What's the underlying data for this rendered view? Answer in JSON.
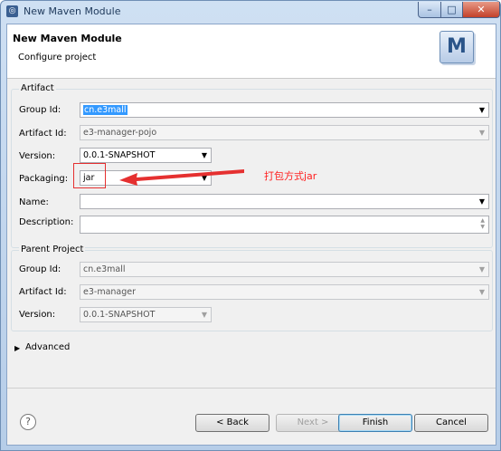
{
  "window": {
    "title": "New Maven Module",
    "controls": {
      "minimize": "–",
      "maximize": "□",
      "close": "✕"
    }
  },
  "header": {
    "title": "New Maven Module",
    "subtitle": "Configure project",
    "logo_letter": "M"
  },
  "artifact": {
    "section_label": "Artifact",
    "group_id_label": "Group Id:",
    "group_id_value": "cn.e3mall",
    "artifact_id_label": "Artifact Id:",
    "artifact_id_value": "e3-manager-pojo",
    "version_label": "Version:",
    "version_value": "0.0.1-SNAPSHOT",
    "packaging_label": "Packaging:",
    "packaging_value": "jar",
    "name_label": "Name:",
    "name_value": "",
    "description_label": "Description:",
    "description_value": ""
  },
  "parent": {
    "section_label": "Parent Project",
    "group_id_label": "Group Id:",
    "group_id_value": "cn.e3mall",
    "artifact_id_label": "Artifact Id:",
    "artifact_id_value": "e3-manager",
    "version_label": "Version:",
    "version_value": "0.0.1-SNAPSHOT"
  },
  "advanced": {
    "label": "Advanced"
  },
  "buttons": {
    "help": "?",
    "back": "< Back",
    "next": "Next >",
    "finish": "Finish",
    "cancel": "Cancel"
  },
  "annotation": {
    "text": "打包方式jar",
    "color": "#ff2020"
  },
  "colors": {
    "selection": "#3399ff",
    "accent_red": "#e53030"
  }
}
